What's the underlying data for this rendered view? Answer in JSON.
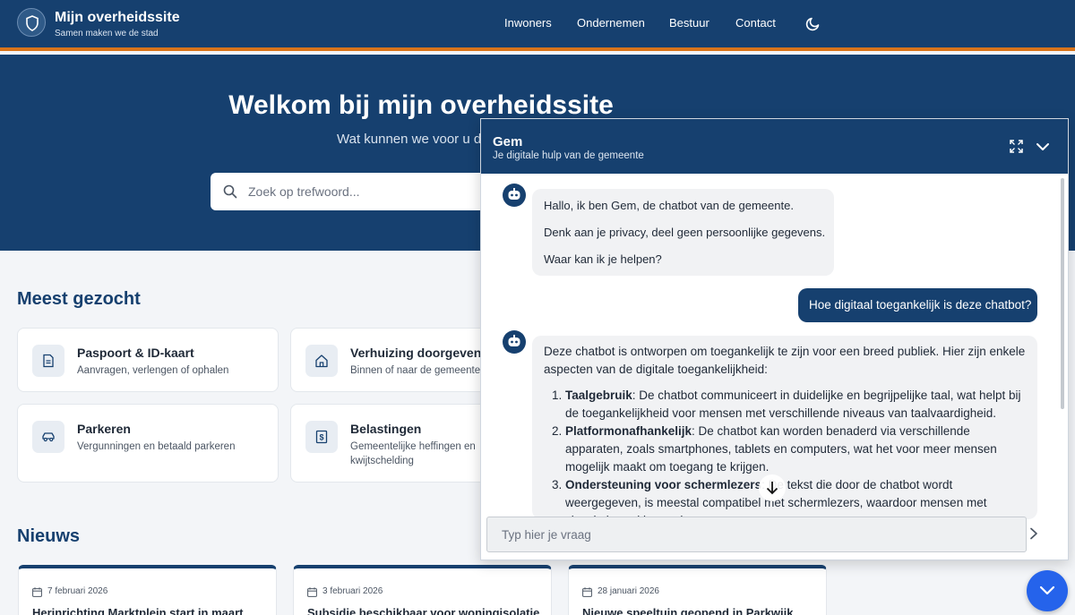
{
  "site": {
    "title": "Mijn overheidssite",
    "subtitle": "Samen maken we de stad",
    "nav": [
      "Inwoners",
      "Ondernemen",
      "Bestuur",
      "Contact"
    ]
  },
  "hero": {
    "title": "Welkom bij mijn overheidssite",
    "subtitle": "Wat kunnen we voor u d",
    "search_placeholder": "Zoek op trefwoord..."
  },
  "popular": {
    "heading": "Meest gezocht",
    "cards": [
      {
        "title": "Paspoort & ID-kaart",
        "desc": "Aanvragen, verlengen of ophalen",
        "icon": "document-icon"
      },
      {
        "title": "Verhuizing doorgeven",
        "desc": "Binnen of naar de gemeente",
        "icon": "home-icon"
      },
      {
        "title": "Parkeren",
        "desc": "Vergunningen en betaald parkeren",
        "icon": "car-icon"
      },
      {
        "title": "Belastingen",
        "desc": "Gemeentelijke heffingen en",
        "desc2": "kwijtschelding",
        "icon": "tax-icon"
      }
    ]
  },
  "news": {
    "heading": "Nieuws",
    "items": [
      {
        "date": "7 februari 2026",
        "title": "Herinrichting Marktplein start in maart"
      },
      {
        "date": "3 februari 2026",
        "title": "Subsidie beschikbaar voor woningisolatie"
      },
      {
        "date": "28 januari 2026",
        "title": "Nieuwe speeltuin geopend in Parkwijk"
      }
    ]
  },
  "chat": {
    "name": "Gem",
    "subtitle": "Je digitale hulp van de gemeente",
    "greeting": [
      "Hallo, ik ben Gem, de chatbot van de gemeente.",
      "Denk aan je privacy, deel geen persoonlijke gegevens.",
      "Waar kan ik je helpen?"
    ],
    "user_message": "Hoe digitaal toegankelijk is deze chatbot?",
    "answer_intro": "Deze chatbot is ontworpen om toegankelijk te zijn voor een breed publiek. Hier zijn enkele aspecten van de digitale toegankelijkheid:",
    "answer_items": [
      {
        "term": "Taalgebruik",
        "text": ": De chatbot communiceert in duidelijke en begrijpelijke taal, wat helpt bij de toegankelijkheid voor mensen met verschillende niveaus van taalvaardigheid."
      },
      {
        "term": "Platformonafhankelijk",
        "text": ": De chatbot kan worden benaderd via verschillende apparaten, zoals smartphones, tablets en computers, wat het voor meer mensen mogelijk maakt om toegang te krijgen."
      },
      {
        "term": "Ondersteuning voor schermlezers",
        "text": ": De tekst die door de chatbot wordt weergegeven, is meestal compatibel met schermlezers, waardoor mensen met visuele beperkingen de"
      }
    ],
    "input_placeholder": "Typ hier je vraag"
  },
  "colors": {
    "primary": "#16406f",
    "accent": "#d8741b",
    "fab": "#2563eb"
  }
}
